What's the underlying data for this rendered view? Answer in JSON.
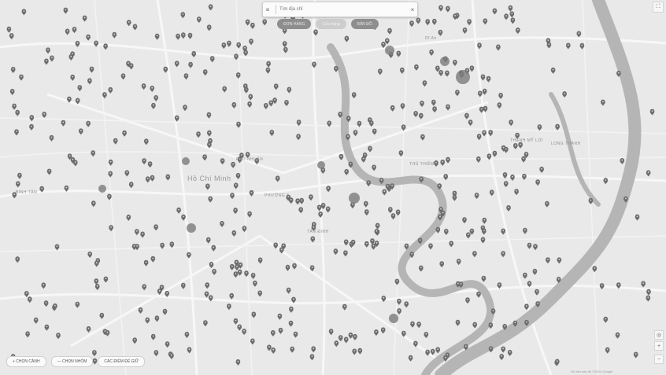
{
  "search": {
    "placeholder": "Tìm địa chỉ"
  },
  "filters": [
    {
      "label": "ĐƠN HÀNG",
      "style": "dark"
    },
    {
      "label": "Cửa hàng",
      "style": "light"
    },
    {
      "label": "BẢN ĐỒ",
      "style": "dark"
    }
  ],
  "bottom_buttons": [
    {
      "label": "+ CHỌN CẢNH"
    },
    {
      "label": "— CHỌN NHÓM"
    },
    {
      "label": "CÁC ĐIỂM ĐỂ GIỮ"
    }
  ],
  "place_labels": [
    {
      "text": "Hồ Chí Minh",
      "size": "large"
    },
    {
      "text": "PHƯỜNG 3",
      "size": "small"
    },
    {
      "text": "TÂN ĐỊNH",
      "size": "small"
    },
    {
      "text": "Dĩ An",
      "size": "small"
    },
    {
      "text": "LONG THÀNH",
      "size": "small"
    },
    {
      "text": "THẠNH MỸ LỢI",
      "size": "small"
    },
    {
      "text": "THỦ THIÊM",
      "size": "small"
    },
    {
      "text": "BÌNH TÂN",
      "size": "small"
    },
    {
      "text": "PHÚ NHUẬN",
      "size": "small"
    }
  ],
  "icons": {
    "marker": "map-pin-icon",
    "cluster": "cluster-icon",
    "menu": "menu-icon",
    "close": "close-icon",
    "zoom_in": "zoom-in-icon",
    "zoom_out": "zoom-out-icon",
    "fullscreen": "fullscreen-icon",
    "locate": "locate-icon"
  },
  "colors": {
    "map_background": "#e9e9e9",
    "river": "#b5b5b5",
    "marker": "#6d6d6d",
    "chip_dark": "#8e8e8e",
    "chip_light": "#cdcdcd"
  },
  "attribution": "Dữ liệu bản đồ ©2024 Google"
}
